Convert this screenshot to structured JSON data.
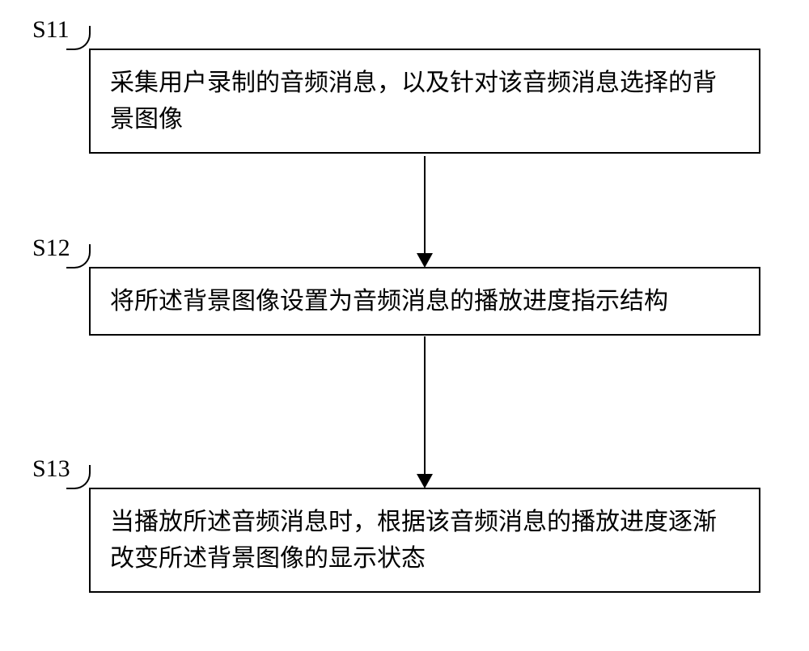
{
  "flowchart": {
    "steps": [
      {
        "label": "S11",
        "text": "采集用户录制的音频消息，以及针对该音频消息选择的背景图像"
      },
      {
        "label": "S12",
        "text": "将所述背景图像设置为音频消息的播放进度指示结构"
      },
      {
        "label": "S13",
        "text": "当播放所述音频消息时，根据该音频消息的播放进度逐渐改变所述背景图像的显示状态"
      }
    ]
  }
}
